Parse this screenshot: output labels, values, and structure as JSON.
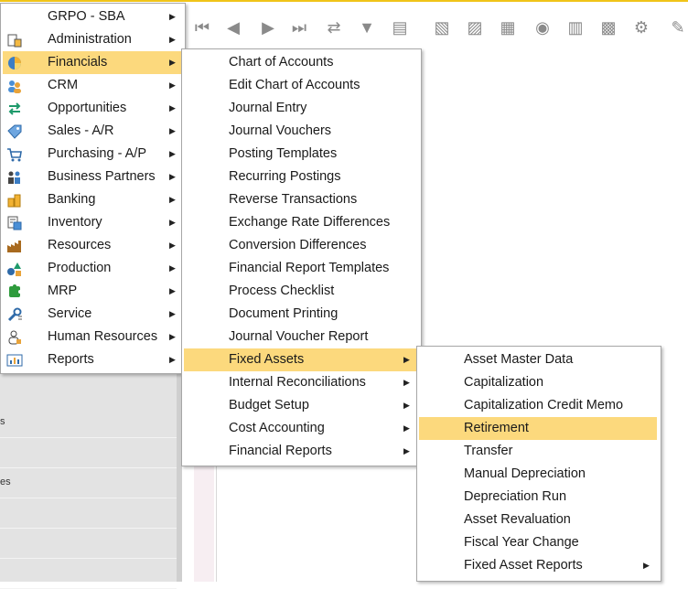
{
  "main_menu": [
    {
      "label": "GRPO - SBA",
      "icon": "none"
    },
    {
      "label": "Administration",
      "icon": "admin-icon"
    },
    {
      "label": "Financials",
      "icon": "pie-chart-icon",
      "selected": true
    },
    {
      "label": "CRM",
      "icon": "people-icon"
    },
    {
      "label": "Opportunities",
      "icon": "arrows-icon"
    },
    {
      "label": "Sales - A/R",
      "icon": "tag-icon"
    },
    {
      "label": "Purchasing - A/P",
      "icon": "cart-icon"
    },
    {
      "label": "Business Partners",
      "icon": "partners-icon"
    },
    {
      "label": "Banking",
      "icon": "coins-icon"
    },
    {
      "label": "Inventory",
      "icon": "inventory-icon"
    },
    {
      "label": "Resources",
      "icon": "factory-icon"
    },
    {
      "label": "Production",
      "icon": "shapes-icon"
    },
    {
      "label": "MRP",
      "icon": "puzzle-icon"
    },
    {
      "label": "Service",
      "icon": "wrench-icon"
    },
    {
      "label": "Human Resources",
      "icon": "person-icon"
    },
    {
      "label": "Reports",
      "icon": "report-icon"
    }
  ],
  "financials_menu": [
    {
      "label": "Chart of Accounts",
      "submenu": false
    },
    {
      "label": "Edit Chart of Accounts",
      "submenu": false
    },
    {
      "label": "Journal Entry",
      "submenu": false
    },
    {
      "label": "Journal Vouchers",
      "submenu": false
    },
    {
      "label": "Posting Templates",
      "submenu": false
    },
    {
      "label": "Recurring Postings",
      "submenu": false
    },
    {
      "label": "Reverse Transactions",
      "submenu": false
    },
    {
      "label": "Exchange Rate Differences",
      "submenu": false
    },
    {
      "label": "Conversion Differences",
      "submenu": false
    },
    {
      "label": "Financial Report Templates",
      "submenu": false
    },
    {
      "label": "Process Checklist",
      "submenu": false
    },
    {
      "label": "Document Printing",
      "submenu": false
    },
    {
      "label": "Journal Voucher Report",
      "submenu": false
    },
    {
      "label": "Fixed Assets",
      "submenu": true,
      "selected": true
    },
    {
      "label": "Internal Reconciliations",
      "submenu": true
    },
    {
      "label": "Budget Setup",
      "submenu": true
    },
    {
      "label": "Cost Accounting",
      "submenu": true
    },
    {
      "label": "Financial Reports",
      "submenu": true
    }
  ],
  "fixed_assets_menu": [
    {
      "label": "Asset Master Data",
      "submenu": false
    },
    {
      "label": "Capitalization",
      "submenu": false
    },
    {
      "label": "Capitalization Credit Memo",
      "submenu": false
    },
    {
      "label": "Retirement",
      "submenu": false,
      "selected": true
    },
    {
      "label": "Transfer",
      "submenu": false
    },
    {
      "label": "Manual Depreciation",
      "submenu": false
    },
    {
      "label": "Depreciation Run",
      "submenu": false
    },
    {
      "label": "Asset Revaluation",
      "submenu": false
    },
    {
      "label": "Fiscal Year Change",
      "submenu": false
    },
    {
      "label": "Fixed Asset Reports",
      "submenu": true
    }
  ],
  "left_panel_fragments": [
    "s",
    "es"
  ],
  "toolbar_icons": [
    "first-record-icon",
    "previous-record-icon",
    "next-record-icon",
    "last-record-icon",
    "refresh-icon",
    "filter-icon",
    "sort-icon",
    "base-document-icon",
    "target-document-icon",
    "document-table-icon",
    "gross-profit-icon",
    "payment-means-icon",
    "volume-weight-icon",
    "journal-icon",
    "settings-icon",
    "edit-icon"
  ],
  "colors": {
    "highlight": "#fcd97d",
    "accent": "#f0c419"
  }
}
